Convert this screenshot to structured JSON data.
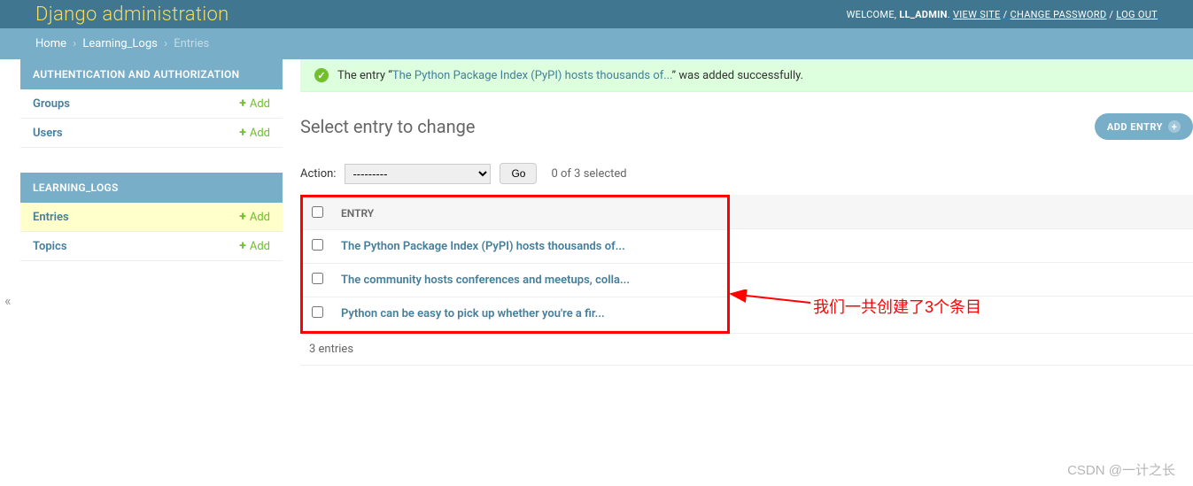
{
  "header": {
    "title": "Django administration",
    "welcome": "WELCOME,",
    "username": "LL_ADMIN",
    "view_site": "VIEW SITE",
    "change_password": "CHANGE PASSWORD",
    "logout": "LOG OUT"
  },
  "breadcrumbs": {
    "home": "Home",
    "app": "Learning_Logs",
    "current": "Entries"
  },
  "sidebar": {
    "add_label": "Add",
    "sections": [
      {
        "caption": "AUTHENTICATION AND AUTHORIZATION",
        "items": [
          {
            "label": "Groups"
          },
          {
            "label": "Users"
          }
        ]
      },
      {
        "caption": "LEARNING_LOGS",
        "items": [
          {
            "label": "Entries",
            "highlight": true
          },
          {
            "label": "Topics"
          }
        ]
      }
    ]
  },
  "message": {
    "prefix": "The entry “",
    "link": "The Python Package Index (PyPI) hosts thousands of...",
    "suffix": "” was added successfully."
  },
  "content": {
    "title": "Select entry to change",
    "add_button": "ADD ENTRY",
    "action_label": "Action:",
    "action_placeholder": "---------",
    "go_button": "Go",
    "selection_counter": "0 of 3 selected",
    "column_header": "ENTRY",
    "rows": [
      {
        "text": "The Python Package Index (PyPI) hosts thousands of..."
      },
      {
        "text": "The community hosts conferences and meetups, colla..."
      },
      {
        "text": "Python can be easy to pick up whether you're a fir..."
      }
    ],
    "paginator": "3 entries"
  },
  "annotation": {
    "text": "我们一共创建了3个条目"
  },
  "watermark": "CSDN @一计之长",
  "collapse_glyph": "«"
}
